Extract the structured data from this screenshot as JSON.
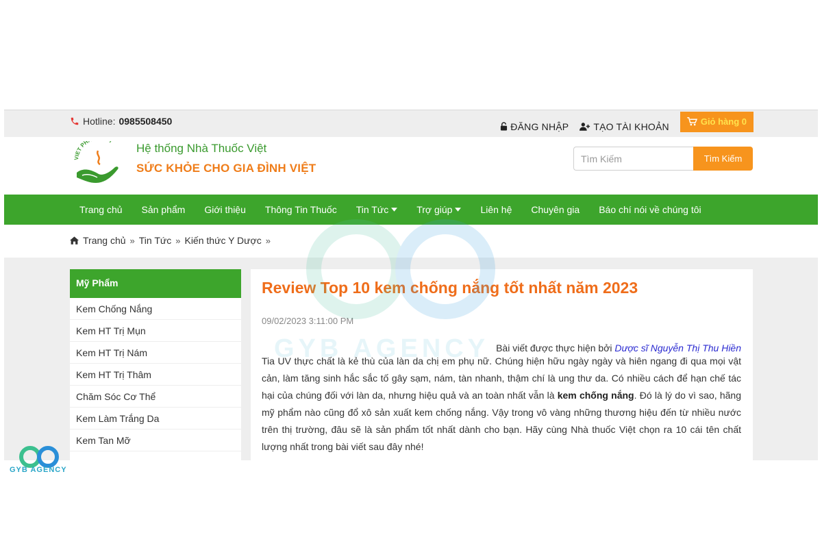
{
  "topbar": {
    "hotline_label": "Hotline:",
    "hotline_number": "0985508450",
    "login": "ĐĂNG NHẬP",
    "register": "TẠO TÀI KHOẢN",
    "cart": "Giỏ hàng 0"
  },
  "header": {
    "brand_line1": "Hệ thống Nhà Thuốc Việt",
    "brand_line2": "SỨC KHỎE CHO GIA ĐÌNH VIỆT",
    "search_placeholder": "Tìm Kiếm",
    "search_button": "Tìm Kiếm",
    "logo_text": "VIET PHARMACY"
  },
  "nav": {
    "items": [
      {
        "label": "Trang chủ"
      },
      {
        "label": "Sản phẩm"
      },
      {
        "label": "Giới thiệu"
      },
      {
        "label": "Thông Tin Thuốc"
      },
      {
        "label": "Tin Tức"
      },
      {
        "label": "Trợ giúp"
      },
      {
        "label": "Liên hệ"
      },
      {
        "label": "Chuyên gia"
      },
      {
        "label": "Báo chí nói về chúng tôi"
      }
    ]
  },
  "breadcrumb": {
    "home": "Trang chủ",
    "news": "Tin Tức",
    "category": "Kiến thức Y Dược"
  },
  "sidebar": {
    "title": "Mỹ Phẩm",
    "items": [
      {
        "label": "Kem Chống Nắng"
      },
      {
        "label": "Kem HT Trị Mụn"
      },
      {
        "label": "Kem HT Trị Nám"
      },
      {
        "label": "Kem HT Trị Thâm"
      },
      {
        "label": "Chăm Sóc Cơ Thể"
      },
      {
        "label": "Kem Làm Trắng Da"
      },
      {
        "label": "Kem Tan Mỡ"
      }
    ]
  },
  "article": {
    "title": "Review Top 10 kem chống nắng tốt nhất năm 2023",
    "date": "09/02/2023 3:11:00 PM",
    "author_prefix": "Bài viết được thực hiện bởi",
    "author_name": "Dược sĩ Nguyễn Thị Thu Hiền",
    "body_part1": "Tia UV thực chất là kẻ thù của làn da chị em phụ nữ. Chúng hiện hữu ngày ngày và hiên ngang đi qua mọi vật cản, làm tăng sinh hắc sắc tố gây sạm, nám, tàn nhanh, thậm chí là ung thư da. Có nhiều cách để hạn chế tác hại của chúng đối với làn da, nhưng hiệu quả và an toàn nhất vẫn là ",
    "body_bold": "kem chống nắng",
    "body_part2": ". Đó là lý do vì sao, hãng mỹ phẩm nào cũng đổ xô sản xuất kem chống nắng. Vậy trong vô vàng những thương hiệu đến từ nhiều nước trên thị trường, đâu sẽ là sản phẩm tốt nhất dành cho bạn. Hãy cùng Nhà thuốc Việt chọn ra 10 cái tên chất lượng nhất trong bài viết sau đây nhé!"
  },
  "watermark": {
    "text": "GYB AGENCY",
    "agency_label": "GYB AGENCY"
  },
  "colors": {
    "green": "#3da52c",
    "orange": "#f7941d",
    "title_orange": "#ef6d1a"
  }
}
